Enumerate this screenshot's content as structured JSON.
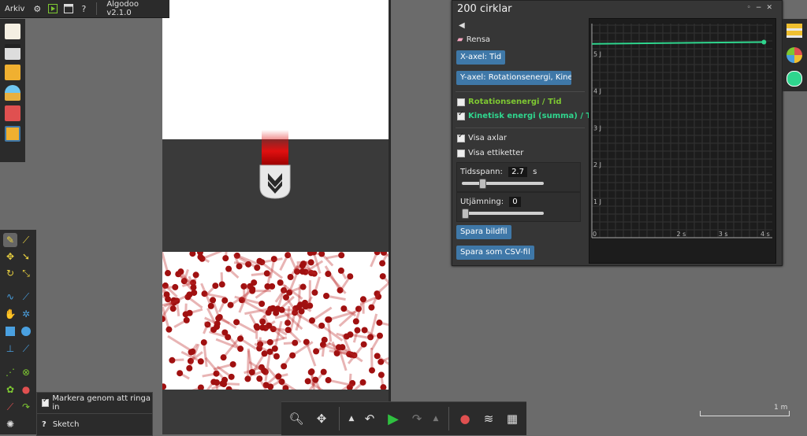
{
  "menu": {
    "file_label": "Arkiv",
    "app_version": "Algodoo v2.1.0"
  },
  "graph_window": {
    "title": "200 cirklar",
    "clear_label": "Rensa",
    "x_axis_button": "X-axel: Tid",
    "y_axis_button": "Y-axel: Rotationsenergi, Kine...",
    "series_toggles": [
      {
        "label": "Rotationsenergi / Tid",
        "checked": false,
        "color": "#7ec832"
      },
      {
        "label": "Kinetisk energi (summa) / Tid",
        "checked": true,
        "color": "#2fd68e"
      }
    ],
    "show_axes_label": "Visa axlar",
    "show_axes_checked": true,
    "show_labels_label": "Visa ettiketter",
    "show_labels_checked": false,
    "timespan_label": "Tidsspann:",
    "timespan_value": "2.7",
    "timespan_unit": "s",
    "timespan_fraction": 0.25,
    "smoothing_label": "Utjämning:",
    "smoothing_value": "0",
    "smoothing_fraction": 0.0,
    "save_image_button": "Spara bildfil",
    "save_csv_button": "Spara som CSV-fil"
  },
  "chart_data": {
    "type": "line",
    "x_tick_labels": [
      "0",
      "2 s",
      "3 s",
      "4 s"
    ],
    "x_ticks": [
      0,
      2,
      3,
      4
    ],
    "y_tick_labels": [
      "1 J",
      "2 J",
      "3 J",
      "4 J",
      "5 J"
    ],
    "y_ticks": [
      1,
      2,
      3,
      4,
      5
    ],
    "xlim": [
      0,
      4.3
    ],
    "ylim": [
      0,
      5.8
    ],
    "grid": true,
    "series": [
      {
        "x": [
          0,
          4.1
        ],
        "y": [
          5.25,
          5.3
        ],
        "color": "#2fd68e"
      }
    ]
  },
  "tooltip": {
    "select_lasso_label": "Markera genom att ringa in",
    "select_lasso_checked": true,
    "sketch_label": "Sketch"
  },
  "scale": {
    "label": "1 m"
  }
}
